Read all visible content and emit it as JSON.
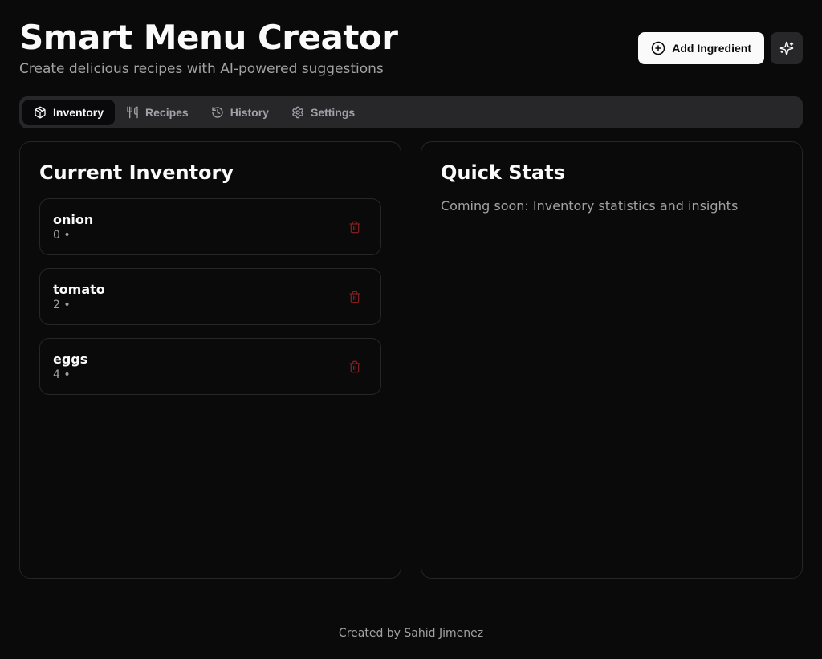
{
  "header": {
    "title": "Smart Menu Creator",
    "subtitle": "Create delicious recipes with AI-powered suggestions",
    "add_button": "Add Ingredient"
  },
  "tabs": [
    {
      "id": "inventory",
      "label": "Inventory",
      "active": true
    },
    {
      "id": "recipes",
      "label": "Recipes",
      "active": false
    },
    {
      "id": "history",
      "label": "History",
      "active": false
    },
    {
      "id": "settings",
      "label": "Settings",
      "active": false
    }
  ],
  "inventory": {
    "heading": "Current Inventory",
    "items": [
      {
        "name": "onion",
        "qty": "0",
        "sep": "•",
        "extra": ""
      },
      {
        "name": "tomato",
        "qty": "2",
        "sep": "•",
        "extra": ""
      },
      {
        "name": "eggs",
        "qty": "4",
        "sep": "•",
        "extra": ""
      }
    ]
  },
  "stats": {
    "heading": "Quick Stats",
    "body": "Coming soon: Inventory statistics and insights"
  },
  "footer": {
    "text": "Created by Sahid Jimenez"
  }
}
